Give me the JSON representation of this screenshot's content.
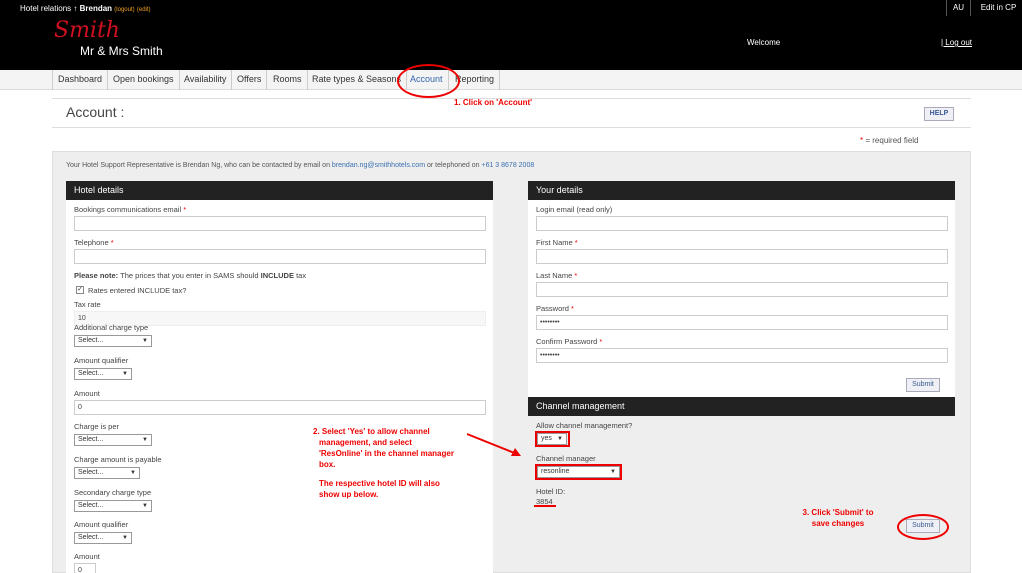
{
  "header": {
    "app_label": "Hotel relations",
    "arrow": "↑",
    "user": "Brendan",
    "logout_small": "(logout)",
    "edit_small": "(edit)",
    "region": "AU",
    "edit_cp": "Edit in CP",
    "logo_script": "Smith",
    "logo_text": "Mr & Mrs Smith",
    "welcome": "Welcome",
    "logout": "| Log out"
  },
  "nav": {
    "tabs": [
      "Dashboard",
      "Open bookings",
      "Availability",
      "Offers",
      "Rooms",
      "Rate types & Seasons",
      "Account",
      "Reporting"
    ],
    "active": "Account"
  },
  "page": {
    "title": "Account :",
    "help": "HELP",
    "required_star": "*",
    "required_text": "= required field",
    "rep_prefix": "Your Hotel Support Representative is Brendan Ng, who can be contacted by email on",
    "rep_email": "brendan.ng@smithhotels.com",
    "rep_middle": "or telephoned on",
    "rep_phone": "+61 3 8678 2008"
  },
  "hotel": {
    "heading": "Hotel details",
    "bookings_email_label": "Bookings communications email",
    "bookings_email_value": "",
    "telephone_label": "Telephone",
    "telephone_value": "",
    "note_bold": "Please note:",
    "note_text": "The prices that you enter in SAMS should",
    "note_include": "INCLUDE",
    "note_tax": "tax",
    "rates_checkbox_label": "Rates entered INCLUDE tax?",
    "rates_checked": true,
    "tax_rate_label": "Tax rate",
    "tax_rate_value": "10",
    "add_charge_type_label": "Additional charge type",
    "add_charge_type_value": "Select...",
    "amount_qualifier_label": "Amount qualifier",
    "amount_qualifier_value": "Select...",
    "amount_label": "Amount",
    "amount_value": "0",
    "charge_per_label": "Charge is per",
    "charge_per_value": "Select...",
    "charge_payable_label": "Charge amount is payable",
    "charge_payable_value": "Select...",
    "secondary_type_label": "Secondary charge type",
    "secondary_type_value": "Select...",
    "amount_qualifier2_label": "Amount qualifier",
    "amount_qualifier2_value": "Select...",
    "amount2_label": "Amount",
    "amount2_value": "0"
  },
  "yours": {
    "heading": "Your details",
    "login_label": "Login email (read only)",
    "login_value": "",
    "first_label": "First Name",
    "first_value": "",
    "last_label": "Last Name",
    "last_value": "",
    "password_label": "Password",
    "password_value": "••••••••",
    "confirm_label": "Confirm Password",
    "confirm_value": "••••••••",
    "submit": "Submit"
  },
  "channel": {
    "heading": "Channel management",
    "allow_label": "Allow channel management?",
    "allow_value": "yes",
    "manager_label": "Channel manager",
    "manager_value": "resonline",
    "hotel_id_label": "Hotel ID:",
    "hotel_id_value": "3854",
    "submit": "Submit"
  },
  "annotations": {
    "step1": "1. Click on 'Account'",
    "step2_l1": "2. Select 'Yes' to allow channel",
    "step2_l2": "management, and select",
    "step2_l3": "'ResOnline' in the channel manager",
    "step2_l4": "box.",
    "step2_l5": "The respective hotel ID will also",
    "step2_l6": "show up below.",
    "step3_l1": "3. Click 'Submit' to",
    "step3_l2": "save changes"
  },
  "colors": {
    "accent_red": "#e00000",
    "link_blue": "#3366aa",
    "header_black": "#000000"
  }
}
